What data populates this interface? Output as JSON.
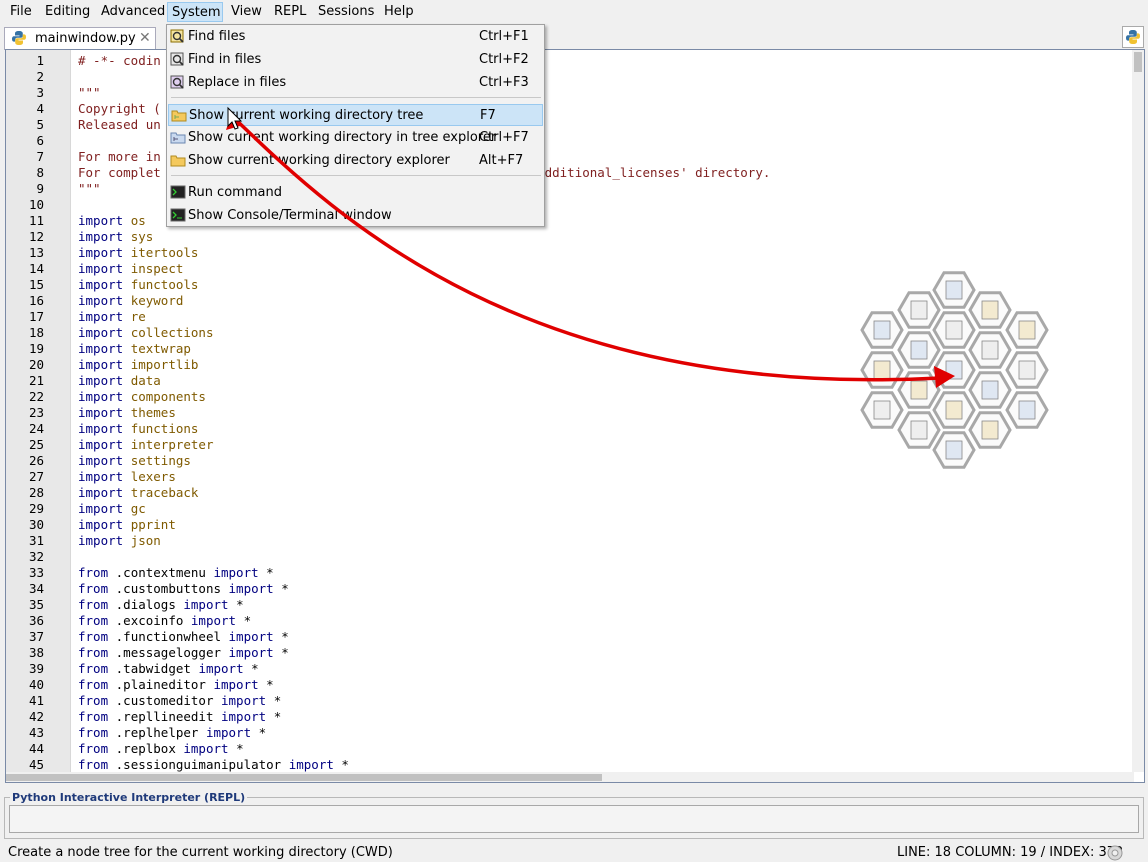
{
  "menubar": {
    "items": [
      "File",
      "Editing",
      "Advanced",
      "System",
      "View",
      "REPL",
      "Sessions",
      "Help"
    ],
    "active": "System"
  },
  "tabs": [
    {
      "label": "mainwindow.py",
      "close": "✕"
    }
  ],
  "dropdown": {
    "items": [
      {
        "label": "Find files",
        "shortcut": "Ctrl+F1",
        "icon": "find-files-icon"
      },
      {
        "label": "Find in files",
        "shortcut": "Ctrl+F2",
        "icon": "find-in-files-icon"
      },
      {
        "label": "Replace in files",
        "shortcut": "Ctrl+F3",
        "icon": "replace-in-files-icon"
      },
      {
        "label": "Show current working directory tree",
        "shortcut": "F7",
        "icon": "folder-tree-icon",
        "highlighted": true
      },
      {
        "label": "Show current working directory in tree explorer",
        "shortcut": "Ctrl+F7",
        "icon": "tree-explorer-icon"
      },
      {
        "label": "Show current working directory explorer",
        "shortcut": "Alt+F7",
        "icon": "folder-icon"
      },
      {
        "label": "Run command",
        "shortcut": "",
        "icon": "terminal-icon"
      },
      {
        "label": "Show Console/Terminal window",
        "shortcut": "",
        "icon": "console-icon"
      }
    ]
  },
  "editor": {
    "lines": [
      {
        "n": "1",
        "t": [
          [
            "cm",
            "# -*- codin"
          ]
        ]
      },
      {
        "n": "2",
        "t": []
      },
      {
        "n": "3",
        "t": [
          [
            "cm",
            "\"\"\""
          ]
        ]
      },
      {
        "n": "4",
        "t": [
          [
            "cm",
            "Copyright ("
          ]
        ]
      },
      {
        "n": "5",
        "t": [
          [
            "cm",
            "Released un"
          ]
        ]
      },
      {
        "n": "6",
        "t": []
      },
      {
        "n": "7",
        "t": [
          [
            "cm",
            "For more in"
          ]
        ]
      },
      {
        "n": "8",
        "t": [
          [
            "cm",
            "For complet"
          ],
          [
            "cm",
            "                                           k the 'additional_licenses' directory."
          ]
        ]
      },
      {
        "n": "9",
        "t": [
          [
            "cm",
            "\"\"\""
          ]
        ]
      },
      {
        "n": "10",
        "t": []
      },
      {
        "n": "11",
        "t": [
          [
            "kw",
            "import "
          ],
          [
            "id",
            "os"
          ]
        ]
      },
      {
        "n": "12",
        "t": [
          [
            "kw",
            "import "
          ],
          [
            "id",
            "sys"
          ]
        ]
      },
      {
        "n": "13",
        "t": [
          [
            "kw",
            "import "
          ],
          [
            "id",
            "itertools"
          ]
        ]
      },
      {
        "n": "14",
        "t": [
          [
            "kw",
            "import "
          ],
          [
            "id",
            "inspect"
          ]
        ]
      },
      {
        "n": "15",
        "t": [
          [
            "kw",
            "import "
          ],
          [
            "id",
            "functools"
          ]
        ]
      },
      {
        "n": "16",
        "t": [
          [
            "kw",
            "import "
          ],
          [
            "id",
            "keyword"
          ]
        ]
      },
      {
        "n": "17",
        "t": [
          [
            "kw",
            "import "
          ],
          [
            "id",
            "re"
          ]
        ]
      },
      {
        "n": "18",
        "t": [
          [
            "kw",
            "import "
          ],
          [
            "id",
            "collections"
          ]
        ]
      },
      {
        "n": "19",
        "t": [
          [
            "kw",
            "import "
          ],
          [
            "id",
            "textwrap"
          ]
        ]
      },
      {
        "n": "20",
        "t": [
          [
            "kw",
            "import "
          ],
          [
            "id",
            "importlib"
          ]
        ]
      },
      {
        "n": "21",
        "t": [
          [
            "kw",
            "import "
          ],
          [
            "id",
            "data"
          ]
        ]
      },
      {
        "n": "22",
        "t": [
          [
            "kw",
            "import "
          ],
          [
            "id",
            "components"
          ]
        ]
      },
      {
        "n": "23",
        "t": [
          [
            "kw",
            "import "
          ],
          [
            "id",
            "themes"
          ]
        ]
      },
      {
        "n": "24",
        "t": [
          [
            "kw",
            "import "
          ],
          [
            "id",
            "functions"
          ]
        ]
      },
      {
        "n": "25",
        "t": [
          [
            "kw",
            "import "
          ],
          [
            "id",
            "interpreter"
          ]
        ]
      },
      {
        "n": "26",
        "t": [
          [
            "kw",
            "import "
          ],
          [
            "id",
            "settings"
          ]
        ]
      },
      {
        "n": "27",
        "t": [
          [
            "kw",
            "import "
          ],
          [
            "id",
            "lexers"
          ]
        ]
      },
      {
        "n": "28",
        "t": [
          [
            "kw",
            "import "
          ],
          [
            "id",
            "traceback"
          ]
        ]
      },
      {
        "n": "29",
        "t": [
          [
            "kw",
            "import "
          ],
          [
            "id",
            "gc"
          ]
        ]
      },
      {
        "n": "30",
        "t": [
          [
            "kw",
            "import "
          ],
          [
            "id",
            "pprint"
          ]
        ]
      },
      {
        "n": "31",
        "t": [
          [
            "kw",
            "import "
          ],
          [
            "id",
            "json"
          ]
        ]
      },
      {
        "n": "32",
        "t": []
      },
      {
        "n": "33",
        "t": [
          [
            "kw",
            "from "
          ],
          [
            "op",
            ".contextmenu "
          ],
          [
            "kw",
            "import "
          ],
          [
            "op",
            "*"
          ]
        ]
      },
      {
        "n": "34",
        "t": [
          [
            "kw",
            "from "
          ],
          [
            "op",
            ".custombuttons "
          ],
          [
            "kw",
            "import "
          ],
          [
            "op",
            "*"
          ]
        ]
      },
      {
        "n": "35",
        "t": [
          [
            "kw",
            "from "
          ],
          [
            "op",
            ".dialogs "
          ],
          [
            "kw",
            "import "
          ],
          [
            "op",
            "*"
          ]
        ]
      },
      {
        "n": "36",
        "t": [
          [
            "kw",
            "from "
          ],
          [
            "op",
            ".excoinfo "
          ],
          [
            "kw",
            "import "
          ],
          [
            "op",
            "*"
          ]
        ]
      },
      {
        "n": "37",
        "t": [
          [
            "kw",
            "from "
          ],
          [
            "op",
            ".functionwheel "
          ],
          [
            "kw",
            "import "
          ],
          [
            "op",
            "*"
          ]
        ]
      },
      {
        "n": "38",
        "t": [
          [
            "kw",
            "from "
          ],
          [
            "op",
            ".messagelogger "
          ],
          [
            "kw",
            "import "
          ],
          [
            "op",
            "*"
          ]
        ]
      },
      {
        "n": "39",
        "t": [
          [
            "kw",
            "from "
          ],
          [
            "op",
            ".tabwidget "
          ],
          [
            "kw",
            "import "
          ],
          [
            "op",
            "*"
          ]
        ]
      },
      {
        "n": "40",
        "t": [
          [
            "kw",
            "from "
          ],
          [
            "op",
            ".plaineditor "
          ],
          [
            "kw",
            "import "
          ],
          [
            "op",
            "*"
          ]
        ]
      },
      {
        "n": "41",
        "t": [
          [
            "kw",
            "from "
          ],
          [
            "op",
            ".customeditor "
          ],
          [
            "kw",
            "import "
          ],
          [
            "op",
            "*"
          ]
        ]
      },
      {
        "n": "42",
        "t": [
          [
            "kw",
            "from "
          ],
          [
            "op",
            ".repllineedit "
          ],
          [
            "kw",
            "import "
          ],
          [
            "op",
            "*"
          ]
        ]
      },
      {
        "n": "43",
        "t": [
          [
            "kw",
            "from "
          ],
          [
            "op",
            ".replhelper "
          ],
          [
            "kw",
            "import "
          ],
          [
            "op",
            "*"
          ]
        ]
      },
      {
        "n": "44",
        "t": [
          [
            "kw",
            "from "
          ],
          [
            "op",
            ".replbox "
          ],
          [
            "kw",
            "import "
          ],
          [
            "op",
            "*"
          ]
        ]
      },
      {
        "n": "45",
        "t": [
          [
            "kw",
            "from "
          ],
          [
            "op",
            ".sessionguimanipulator "
          ],
          [
            "kw",
            "import "
          ],
          [
            "op",
            "*"
          ]
        ]
      }
    ]
  },
  "repl": {
    "title": "Python Interactive Interpreter (REPL)",
    "value": ""
  },
  "status": {
    "message": "Create a node tree for the current working directory (CWD)",
    "position": "LINE: 18 COLUMN: 19 / INDEX: 372"
  },
  "colors": {
    "keyword": "#000080",
    "identifier": "#7f5a00",
    "comment": "#7f1f1f",
    "annotation_arrow": "#e00000",
    "highlight": "#cce4f7"
  }
}
